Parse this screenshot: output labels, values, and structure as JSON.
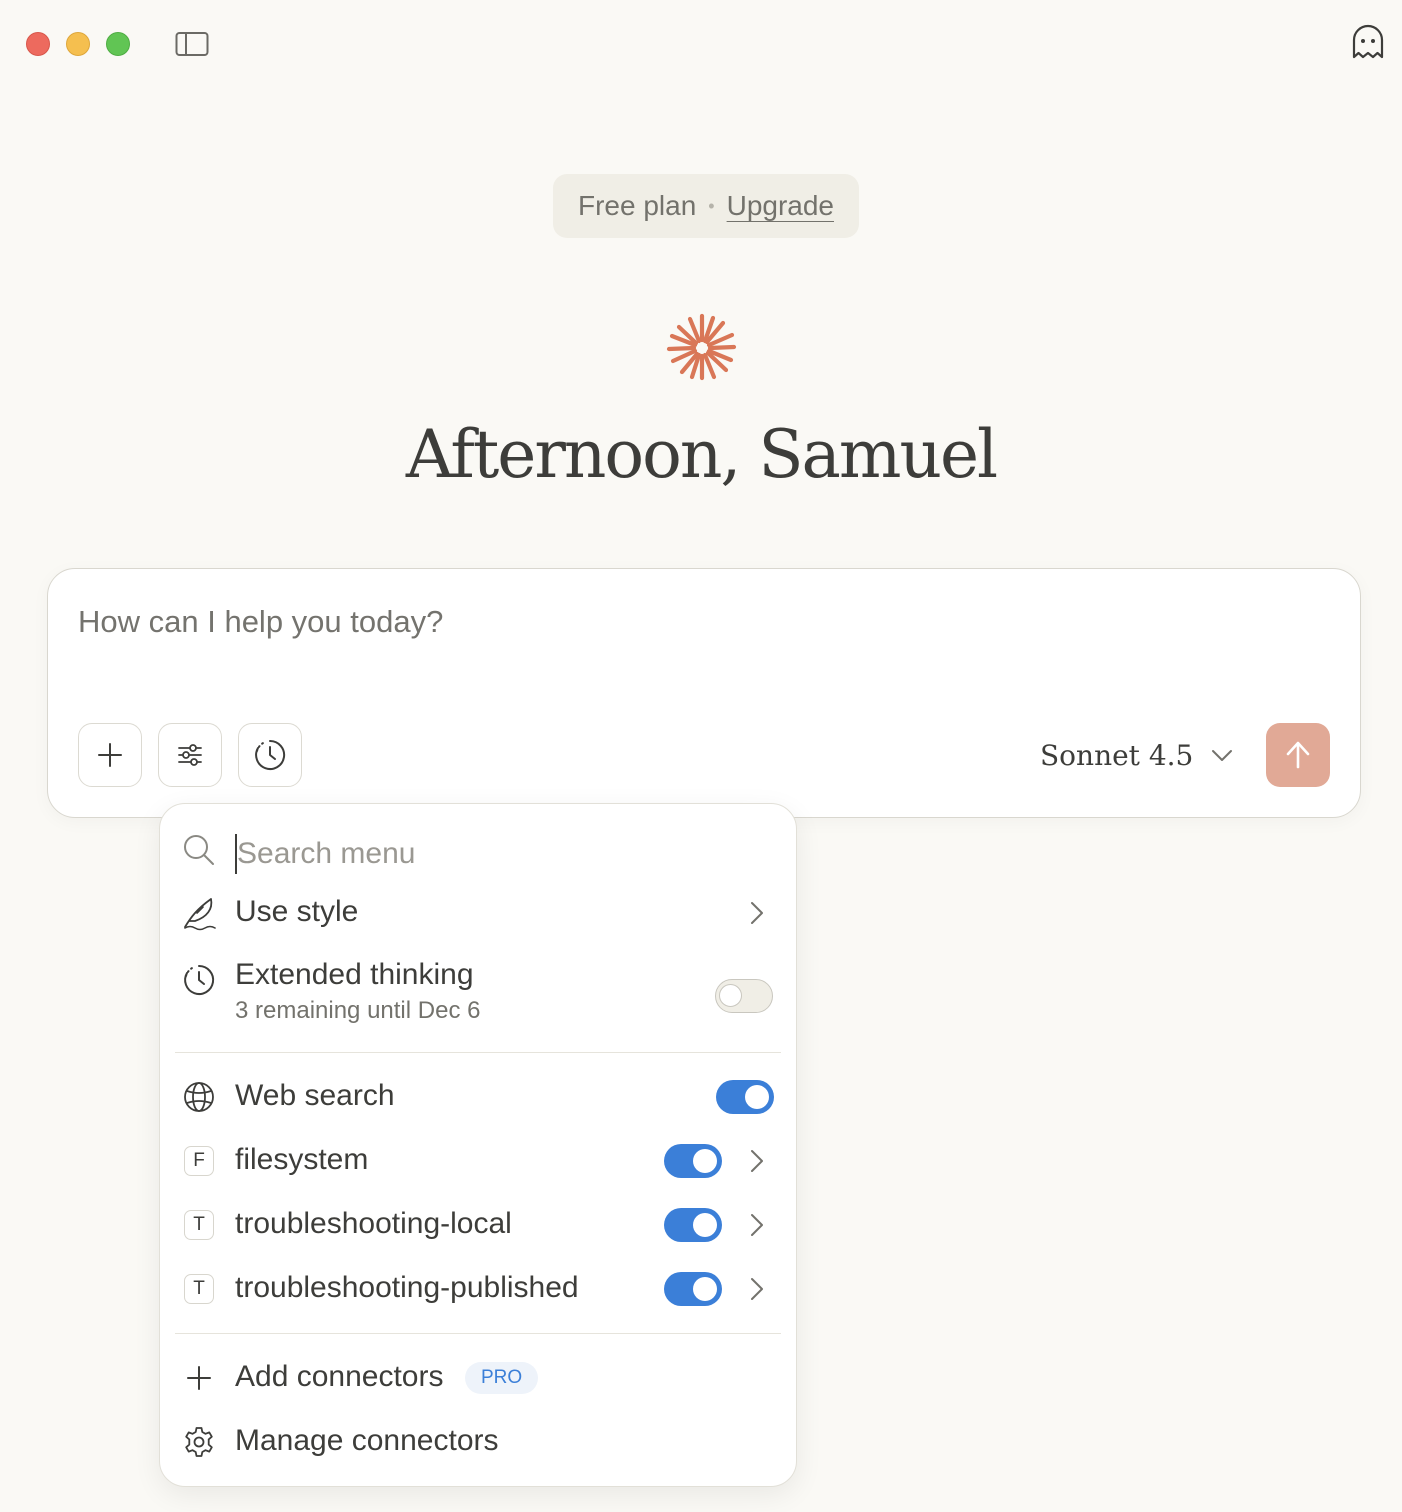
{
  "window": {
    "sidebar_toggle_icon": "sidebar-icon",
    "ghost_icon": "ghost-icon"
  },
  "plan": {
    "label": "Free plan",
    "separator": "•",
    "upgrade_label": "Upgrade"
  },
  "greeting": "Afternoon, Samuel",
  "composer": {
    "placeholder": "How can I help you today?",
    "model_label": "Sonnet 4.5",
    "accent_color": "#e1a996"
  },
  "menu": {
    "search_placeholder": "Search menu",
    "items": [
      {
        "label": "Use style",
        "icon": "feather-icon",
        "has_submenu": true
      },
      {
        "label": "Extended thinking",
        "sublabel": "3 remaining until Dec 6",
        "icon": "clock-icon",
        "toggle": false
      },
      {
        "label": "Web search",
        "icon": "globe-icon",
        "toggle": true
      },
      {
        "label": "filesystem",
        "badge": "F",
        "toggle": true,
        "has_submenu": true
      },
      {
        "label": "troubleshooting-local",
        "badge": "T",
        "toggle": true,
        "has_submenu": true
      },
      {
        "label": "troubleshooting-published",
        "badge": "T",
        "toggle": true,
        "has_submenu": true
      },
      {
        "label": "Add connectors",
        "icon": "plus-icon",
        "pro_badge": "PRO"
      },
      {
        "label": "Manage connectors",
        "icon": "gear-icon"
      }
    ],
    "toggle_on_color": "#3b7fd8"
  }
}
